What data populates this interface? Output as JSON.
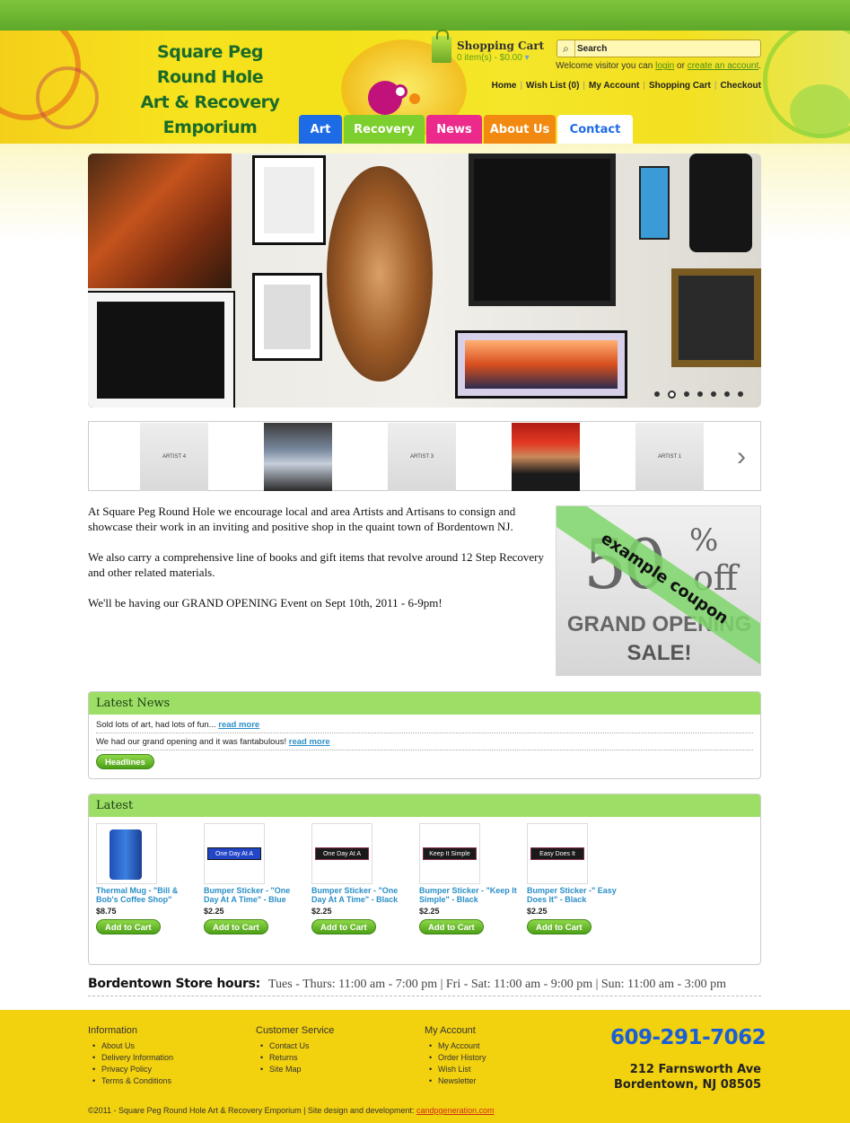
{
  "site": {
    "logo_lines": [
      "Square Peg",
      "Round Hole",
      "Art & Recovery",
      "Emporium"
    ]
  },
  "cart": {
    "title": "Shopping Cart",
    "summary": "0 item(s) - $0.00"
  },
  "search": {
    "placeholder": "Search",
    "icon": "search-icon"
  },
  "welcome": {
    "prefix": "Welcome visitor you can",
    "login": "login",
    "or": "or",
    "create": "create an account",
    "suffix": "."
  },
  "top_links": [
    "Home",
    "Wish List (0)",
    "My Account",
    "Shopping Cart",
    "Checkout"
  ],
  "nav_tabs": [
    {
      "label": "Art",
      "color": "#1e6be6"
    },
    {
      "label": "Recovery",
      "color": "#7ccf2c"
    },
    {
      "label": "News",
      "color": "#ec2a8c"
    },
    {
      "label": "About Us",
      "color": "#f28a12"
    },
    {
      "label": "Contact",
      "color": "#ffffff"
    }
  ],
  "slider": {
    "dots": 7,
    "active_dot": 2
  },
  "carousel": {
    "thumbs": [
      "ARTIST 4",
      "",
      "ARTIST 3",
      "",
      "ARTIST 1"
    ]
  },
  "intro": {
    "p1": "At Square Peg Round Hole we encourage local and area Artists and Artisans to consign and showcase their work in an inviting and positive shop in the quaint town of Bordentown NJ.",
    "p2": "We also carry a comprehensive line of books and gift items that revolve around 12 Step Recovery and other related materials.",
    "p3": "We'll be having our GRAND OPENING Event on Sept 10th, 2011  -  6-9pm!"
  },
  "coupon": {
    "number": "50",
    "percent": "%",
    "off": "off",
    "line1": "GRAND OPENING",
    "line2": "SALE!",
    "ribbon": "example coupon"
  },
  "latest_news": {
    "title": "Latest News",
    "items": [
      {
        "text": "Sold lots of art, had lots of fun...",
        "link": "read more"
      },
      {
        "text": "We had our grand opening and it was fantabulous!",
        "link": "read more"
      }
    ],
    "button": "Headlines"
  },
  "latest": {
    "title": "Latest",
    "products": [
      {
        "name": "Thermal Mug - \"Bill & Bob's Coffee Shop\"",
        "price": "$8.75",
        "button": "Add to Cart",
        "sticker": ""
      },
      {
        "name": "Bumper Sticker - \"One Day At A Time\" - Blue",
        "price": "$2.25",
        "button": "Add to Cart",
        "sticker": "One Day At A Time"
      },
      {
        "name": "Bumper Sticker - \"One Day At A Time\" - Black",
        "price": "$2.25",
        "button": "Add to Cart",
        "sticker": "One Day At A Time"
      },
      {
        "name": "Bumper Sticker - \"Keep It Simple\" - Black",
        "price": "$2.25",
        "button": "Add to Cart",
        "sticker": "Keep It Simple"
      },
      {
        "name": "Bumper Sticker -\" Easy Does It\" - Black",
        "price": "$2.25",
        "button": "Add to Cart",
        "sticker": "Easy Does It"
      }
    ]
  },
  "hours": {
    "label": "Bordentown Store hours:",
    "text": "Tues - Thurs: 11:00 am - 7:00 pm  |  Fri - Sat: 11:00 am - 9:00 pm  |  Sun: 11:00 am - 3:00 pm"
  },
  "footer": {
    "columns": [
      {
        "title": "Information",
        "links": [
          "About Us",
          "Delivery Information",
          "Privacy Policy",
          "Terms & Conditions"
        ]
      },
      {
        "title": "Customer Service",
        "links": [
          "Contact Us",
          "Returns",
          "Site Map"
        ]
      },
      {
        "title": "My Account",
        "links": [
          "My Account",
          "Order History",
          "Wish List",
          "Newsletter"
        ]
      }
    ],
    "phone": "609-291-7062",
    "address_line1": "212 Farnsworth Ave",
    "address_line2": "Bordentown, NJ 08505",
    "copyright": "©2011 - Square Peg Round Hole Art & Recovery Emporium   |   Site design and development:",
    "designer_link": "candpgeneration.com"
  }
}
